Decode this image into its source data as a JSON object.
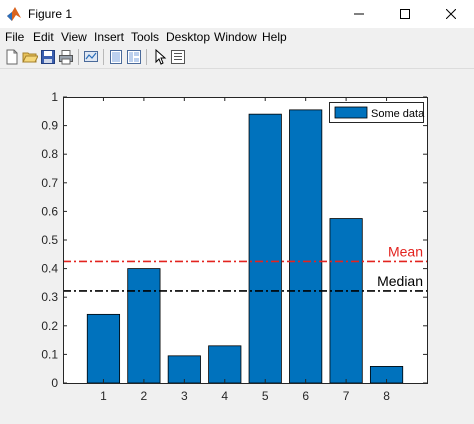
{
  "window": {
    "title": "Figure 1",
    "minimize_label": "—",
    "maximize_label": "☐",
    "close_label": "✕"
  },
  "menu": [
    {
      "label": "File",
      "key": "F"
    },
    {
      "label": "Edit",
      "key": "E"
    },
    {
      "label": "View",
      "key": "V"
    },
    {
      "label": "Insert",
      "key": "I"
    },
    {
      "label": "Tools",
      "key": "T"
    },
    {
      "label": "Desktop",
      "key": "D"
    },
    {
      "label": "Window",
      "key": "W"
    },
    {
      "label": "Help",
      "key": "H"
    }
  ],
  "toolbar": {
    "icons": [
      "new-figure-icon",
      "open-file-icon",
      "save-icon",
      "print-icon",
      "link-plot-icon",
      "hide-plot-tools-icon",
      "show-plot-tools-icon",
      "pointer-icon",
      "property-inspector-icon"
    ]
  },
  "colors": {
    "bar": "#0072BD",
    "mean": "#E3231F",
    "median": "#000000"
  },
  "chart_data": {
    "type": "bar",
    "categories": [
      "1",
      "2",
      "3",
      "4",
      "5",
      "6",
      "7",
      "8"
    ],
    "series": [
      {
        "name": "Some data",
        "values": [
          0.24,
          0.4,
          0.095,
          0.13,
          0.94,
          0.955,
          0.575,
          0.058
        ]
      }
    ],
    "ylim": [
      0,
      1
    ],
    "yticks": [
      "0",
      "0.1",
      "0.2",
      "0.3",
      "0.4",
      "0.5",
      "0.6",
      "0.7",
      "0.8",
      "0.9",
      "1"
    ],
    "xlim": [
      0,
      9
    ],
    "reference_lines": [
      {
        "label": "Mean",
        "value": 0.425,
        "style": "dash-dot",
        "color": "#E3231F"
      },
      {
        "label": "Median",
        "value": 0.322,
        "style": "dash-dot",
        "color": "#000000"
      }
    ],
    "legend": {
      "position": "top-right",
      "entries": [
        "Some data"
      ]
    },
    "grid": false
  }
}
